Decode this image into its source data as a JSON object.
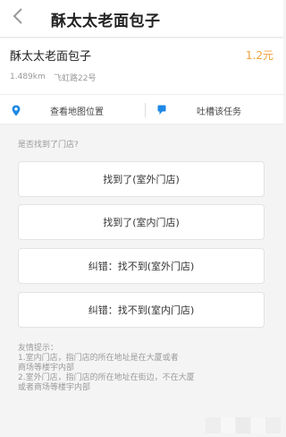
{
  "header": {
    "title": "酥太太老面包子",
    "back_icon": "chevron-left-icon"
  },
  "store": {
    "name": "酥太太老面包子",
    "price": "1.2元",
    "distance": "1.489km",
    "address": "飞虹路22号",
    "price_color": "#f0a23c"
  },
  "actions": {
    "map": {
      "label": "查看地图位置",
      "icon": "location-pin-icon"
    },
    "report": {
      "label": "吐槽该任务",
      "icon": "flag-icon"
    },
    "accent": "#1e88e5"
  },
  "question": "是否找到了门店?",
  "options": [
    "找到了(室外门店)",
    "找到了(室内门店)",
    "纠错：找不到(室外门店)",
    "纠错：找不到(室内门店)"
  ],
  "tips": {
    "title": "友情提示：",
    "lines": [
      "1.室内门店，指门店的所在地址是在大厦或者",
      "商场等楼宇内部",
      "2.室外门店，指门店的所在地址在街边，不在大厦",
      "或者商场等楼宇内部"
    ]
  }
}
